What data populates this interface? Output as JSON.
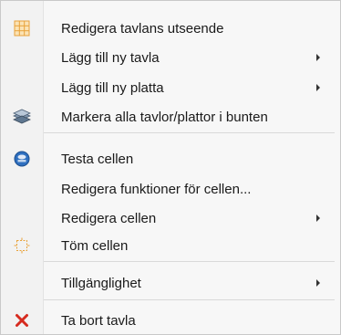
{
  "menu": {
    "items": [
      {
        "label": "Redigera tavlans utseende",
        "icon": "grid-icon"
      },
      {
        "label": "Lägg till ny tavla",
        "submenu": true
      },
      {
        "label": "Lägg till ny platta",
        "submenu": true
      },
      {
        "label": "Markera alla tavlor/plattor i bunten",
        "icon": "stack-icon"
      },
      {
        "label": "Testa cellen",
        "icon": "play-icon"
      },
      {
        "label": "Redigera funktioner för cellen..."
      },
      {
        "label": "Redigera cellen",
        "submenu": true
      },
      {
        "label": "Töm cellen",
        "icon": "clear-cell-icon"
      },
      {
        "label": "Tillgänglighet",
        "submenu": true
      },
      {
        "label": "Ta bort tavla",
        "icon": "delete-icon"
      }
    ]
  },
  "colors": {
    "delete": "#d62b1f",
    "play": "#2e6fbf",
    "grid": "#e8a23a"
  }
}
